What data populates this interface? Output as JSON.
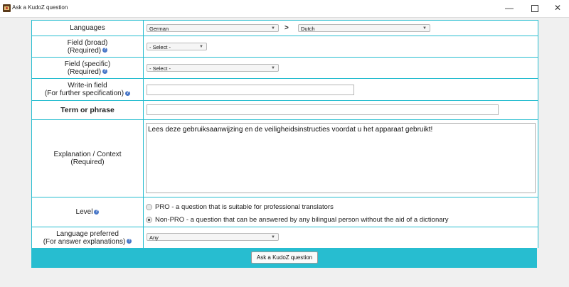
{
  "window": {
    "title": "Ask a KudoZ question",
    "minimize": "—",
    "close": "✕"
  },
  "form": {
    "languages": {
      "label": "Languages",
      "source": "German",
      "separator": ">",
      "target": "Dutch"
    },
    "field_broad": {
      "label": "Field (broad)",
      "sub": "(Required)",
      "value": "- Select -"
    },
    "field_specific": {
      "label": "Field (specific)",
      "sub": "(Required)",
      "value": "- Select -"
    },
    "write_in": {
      "label": "Write-in field",
      "sub": "(For further specification)",
      "value": ""
    },
    "term": {
      "label": "Term or phrase",
      "value": ""
    },
    "explanation": {
      "label": "Explanation / Context",
      "sub": "(Required)",
      "value": "Lees deze gebruiksaanwijzing en de veiligheidsinstructies voordat u het apparaat gebruikt!"
    },
    "level": {
      "label": "Level",
      "options": [
        {
          "label": "PRO - a question that is suitable for professional translators",
          "selected": false
        },
        {
          "label": "Non-PRO - a question that can be answered by any bilingual person without the aid of a dictionary",
          "selected": true
        }
      ]
    },
    "language_preferred": {
      "label": "Language preferred",
      "sub": "(For answer explanations)",
      "value": "Any"
    },
    "submit_label": "Ask a KudoZ question"
  },
  "colors": {
    "accent": "#27bdd0",
    "help_icon": "#4a78c8"
  }
}
